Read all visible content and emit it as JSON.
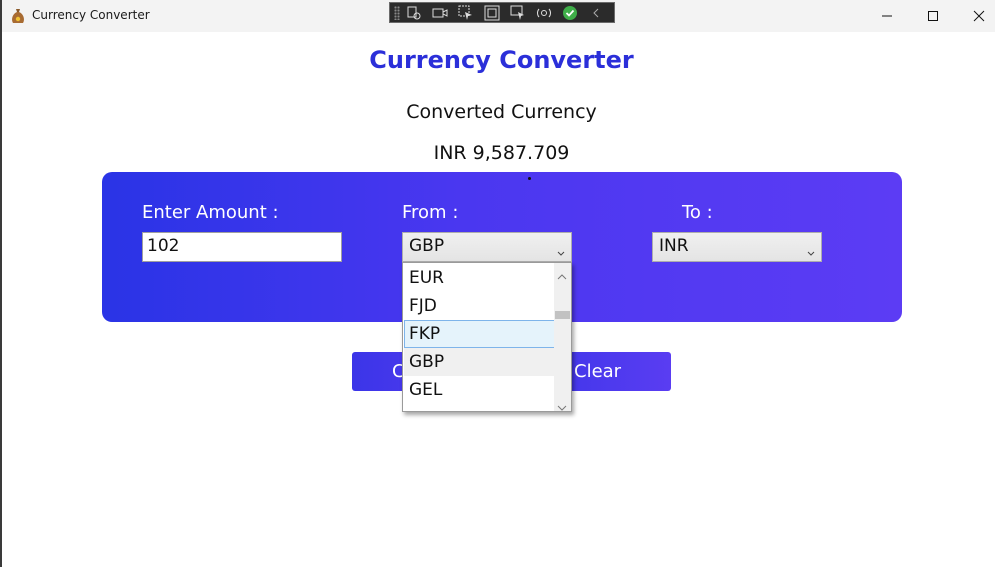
{
  "window": {
    "title": "Currency Converter"
  },
  "app": {
    "heading": "Currency Converter",
    "result_label": "Converted Currency",
    "result_value": "INR 9,587.709"
  },
  "form": {
    "amount_label": "Enter Amount :",
    "amount_value": "102",
    "from_label": "From :",
    "from_selected": "GBP",
    "to_label": "To :",
    "to_selected": "INR"
  },
  "buttons": {
    "convert_label": "C",
    "clear_label": "Clear"
  },
  "dropdown": {
    "items": [
      {
        "label": "EUR"
      },
      {
        "label": "FJD"
      },
      {
        "label": "FKP"
      },
      {
        "label": "GBP"
      },
      {
        "label": "GEL"
      }
    ],
    "hovered": "FKP",
    "selected": "GBP"
  },
  "colors": {
    "accent": "#2b2fd9",
    "panel_start": "#2a34e6",
    "panel_end": "#5c3cf4"
  },
  "icons": {
    "app": "money-bag-icon",
    "minimize": "minimize-icon",
    "maximize": "maximize-icon",
    "close": "close-icon",
    "debug_check": "check-circle-icon"
  }
}
